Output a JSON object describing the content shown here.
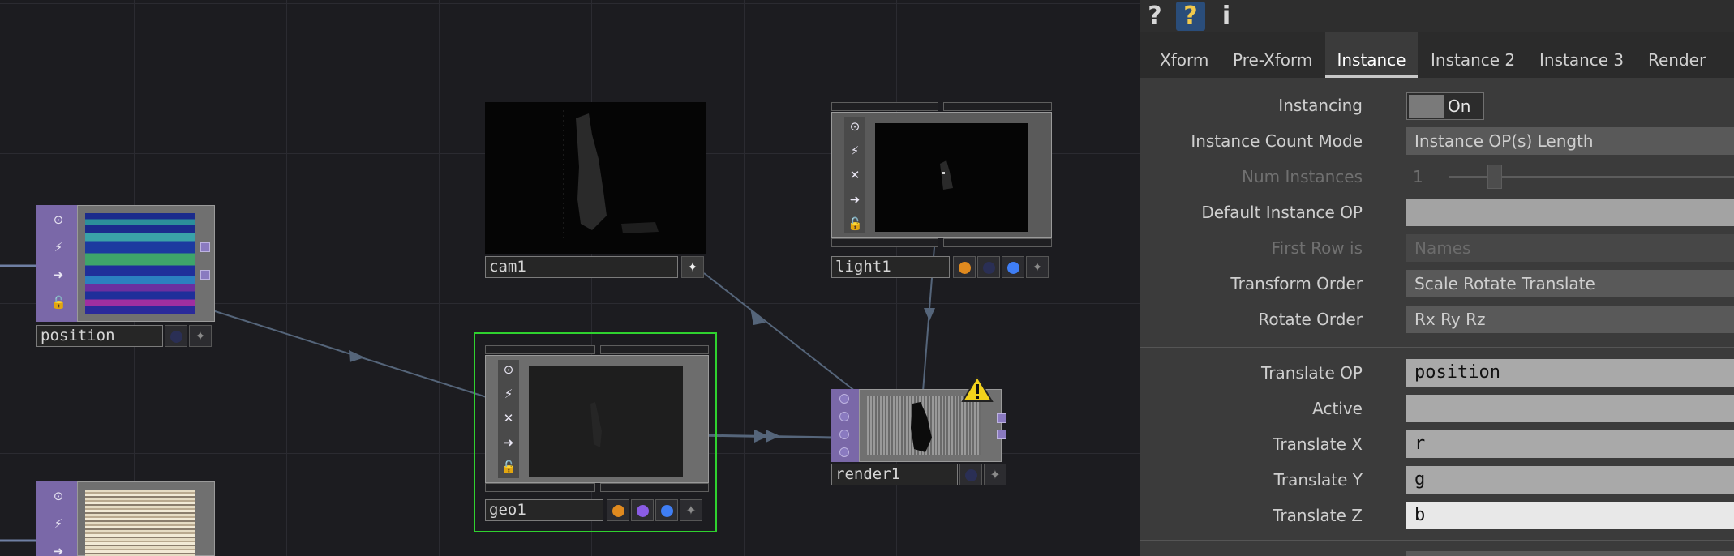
{
  "network": {
    "nodes": {
      "position": {
        "label": "position"
      },
      "noise": {
        "label": ""
      },
      "cam1": {
        "label": "cam1"
      },
      "light1": {
        "label": "light1"
      },
      "geo1": {
        "label": "geo1"
      },
      "render1": {
        "label": "render1"
      }
    },
    "colors": {
      "selected_outline": "#2fd12f",
      "sidebar": "#7a68a8",
      "wire": "#5a6a7a"
    }
  },
  "panel": {
    "toolbar": {
      "help": "?",
      "python_help": "?",
      "info": "i"
    },
    "tabs": [
      "Xform",
      "Pre-Xform",
      "Instance",
      "Instance 2",
      "Instance 3",
      "Render"
    ],
    "active_tab": "Instance",
    "params": {
      "instancing": {
        "label": "Instancing",
        "value": "On"
      },
      "instance_count_mode": {
        "label": "Instance Count Mode",
        "value": "Instance OP(s) Length"
      },
      "num_instances": {
        "label": "Num Instances",
        "value": "1"
      },
      "default_instance_op": {
        "label": "Default Instance OP",
        "value": ""
      },
      "first_row_is": {
        "label": "First Row is",
        "value": "Names"
      },
      "transform_order": {
        "label": "Transform Order",
        "value": "Scale Rotate Translate"
      },
      "rotate_order": {
        "label": "Rotate Order",
        "value": "Rx Ry Rz"
      },
      "translate_op": {
        "label": "Translate OP",
        "value": "position"
      },
      "active": {
        "label": "Active",
        "value": ""
      },
      "translate_x": {
        "label": "Translate X",
        "value": "r"
      },
      "translate_y": {
        "label": "Translate Y",
        "value": "g"
      },
      "translate_z": {
        "label": "Translate Z",
        "value": "b"
      }
    }
  }
}
